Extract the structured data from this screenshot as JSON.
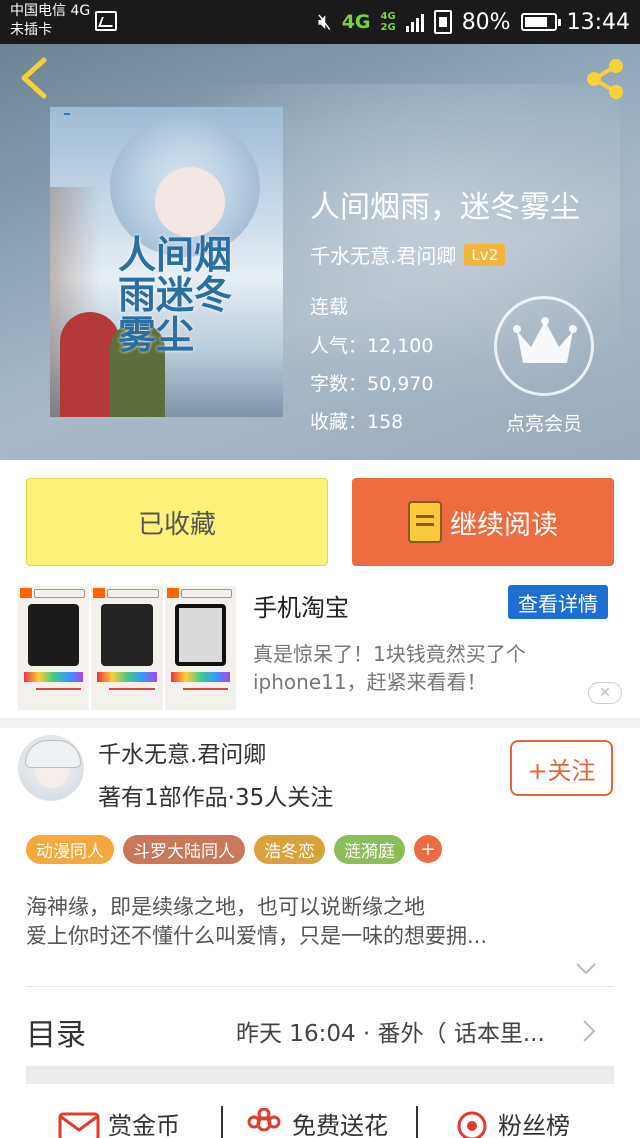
{
  "status_bar": {
    "carrier_line1": "中国电信 4G",
    "carrier_line2": "未插卡",
    "network_primary": "4G",
    "network_secondary_top": "4G",
    "network_secondary_bottom": "2G",
    "battery": "80%",
    "battery_level": 0.8,
    "time": "13:44"
  },
  "book": {
    "title": "人间烟雨，迷冬雾尘",
    "cover_title_text": "人间烟雨迷冬雾尘",
    "author": "千水无意.君问卿",
    "author_level": "Lv2",
    "status": "连载",
    "popularity": "人气：12,100",
    "word_count": "字数：50,970",
    "favorites": "收藏：158",
    "vip_label": "点亮会员"
  },
  "actions": {
    "collected_label": "已收藏",
    "continue_label": "继续阅读"
  },
  "ad": {
    "title": "手机淘宝",
    "detail_button": "查看详情",
    "description": "真是惊呆了！1块钱竟然买了个iphone11，赶紧来看看！",
    "close_label": "✕"
  },
  "author_card": {
    "name": "千水无意.君问卿",
    "meta": "著有1部作品·35人关注",
    "follow_label": "+关注"
  },
  "tags": [
    {
      "label": "动漫同人",
      "color": "#f3a93c"
    },
    {
      "label": "斗罗大陆同人",
      "color": "#c9785a"
    },
    {
      "label": "浩冬恋",
      "color": "#d9a23a"
    },
    {
      "label": "涟漪庭",
      "color": "#8bbd5a"
    }
  ],
  "tag_more": "+",
  "intro": {
    "line1": "海神缘，即是续缘之地，也可以说断缘之地",
    "line2": "爱上你时还不懂什么叫爱情，只是一味的想要拥..."
  },
  "catalog": {
    "label": "目录",
    "latest": "昨天 16:04 · 番外（ 话本里..."
  },
  "bottom_actions": {
    "reward": "赏金币",
    "flowers": "免费送花",
    "fans": "粉丝榜"
  },
  "colors": {
    "accent_orange": "#ee6b3f",
    "collected_yellow": "#fbf27a",
    "ad_blue": "#1d6fd3",
    "level_badge": "#f3b53c"
  }
}
